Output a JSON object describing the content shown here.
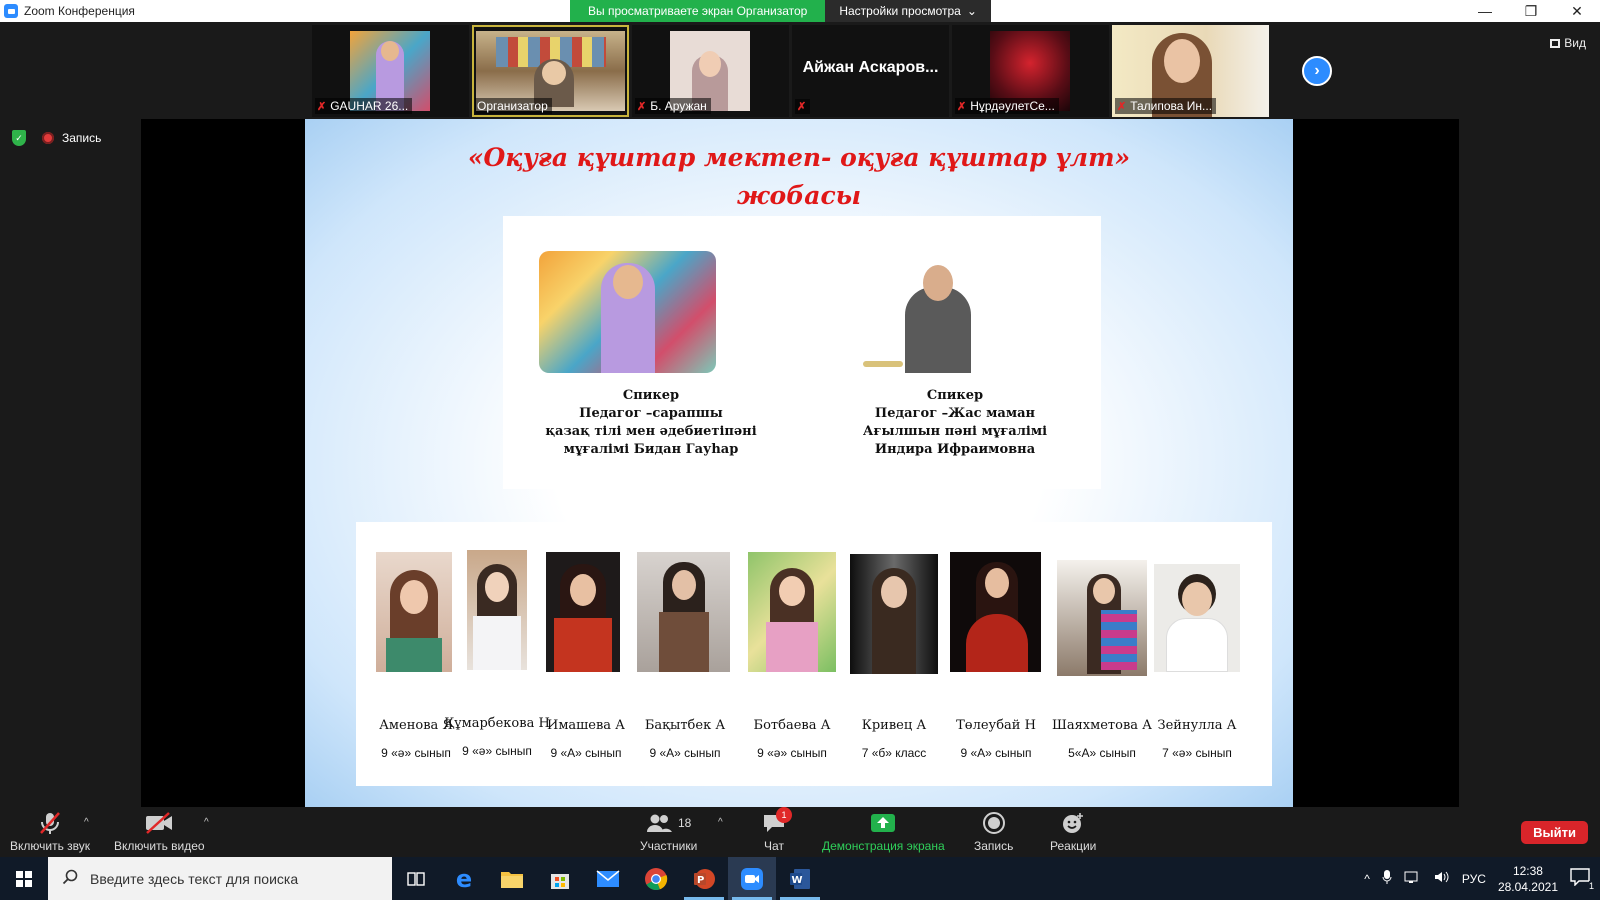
{
  "window": {
    "title": "Zoom Конференция",
    "viewing_banner": "Вы просматриваете экран Организатор",
    "view_settings": "Настройки просмотра",
    "controls": {
      "minimize": "—",
      "restore": "❐",
      "close": "✕"
    }
  },
  "gallery": {
    "participants": [
      {
        "name": "GAUHAR 26...",
        "muted": true,
        "has_video": true
      },
      {
        "name": "Организатор",
        "muted": false,
        "has_video": true,
        "active": true
      },
      {
        "name": "Б. Аружан",
        "muted": true,
        "has_video": true
      },
      {
        "name": "Айжан Аскаров...",
        "muted": true,
        "has_video": false
      },
      {
        "name": "НұрдәулетСе...",
        "muted": true,
        "has_video": true
      },
      {
        "name": "Талипова Ин...",
        "muted": true,
        "has_video": true
      }
    ],
    "view_label": "Вид"
  },
  "status": {
    "recording_label": "Запись"
  },
  "slide": {
    "title_line1": "«Оқуға құштар мектеп- оқуға құштар ұлт»",
    "title_line2": "жобасы",
    "speakers": [
      {
        "lines": [
          "Спикер",
          "Педагог –сарапшы",
          "қазақ тілі мен әдебиетіпәні",
          "мұғалімі  Бидан Гауһар"
        ]
      },
      {
        "lines": [
          "Спикер",
          "Педагог –Жас маман",
          "Ағылшын  пәні мұғалімі",
          "Индира Ифраимовна"
        ]
      }
    ],
    "students": [
      {
        "name": "Аменова Я",
        "class": "9 «ә» сынып"
      },
      {
        "name": "Құмарбекова Н",
        "class": "9 «ә» сынып"
      },
      {
        "name": "Имашева А",
        "class": "9 «А» сынып"
      },
      {
        "name": "Бақытбек А",
        "class": "9 «А» сынып"
      },
      {
        "name": "Ботбаева А",
        "class": "9 «ә» сынып"
      },
      {
        "name": "Кривец А",
        "class": "7 «б» класс"
      },
      {
        "name": "Төлеубай Н",
        "class": "9 «А» сынып"
      },
      {
        "name": "Шаяхметова А",
        "class": "5«А» сынып"
      },
      {
        "name": "Зейнулла А",
        "class": "7 «ә» сынып"
      }
    ]
  },
  "toolbar": {
    "unmute": "Включить звук",
    "start_video": "Включить видео",
    "participants": "Участники",
    "participants_count": "18",
    "chat": "Чат",
    "chat_badge": "1",
    "share_screen": "Демонстрация экрана",
    "record": "Запись",
    "reactions": "Реакции",
    "leave": "Выйти"
  },
  "taskbar": {
    "search_placeholder": "Введите здесь текст для поиска",
    "language": "РУС",
    "time": "12:38",
    "date": "28.04.2021",
    "notification_count": "1"
  },
  "colors": {
    "zoom_blue": "#2d8cff",
    "banner_green": "#22b14c",
    "leave_red": "#d9252a",
    "slide_title_red": "#e01818"
  }
}
